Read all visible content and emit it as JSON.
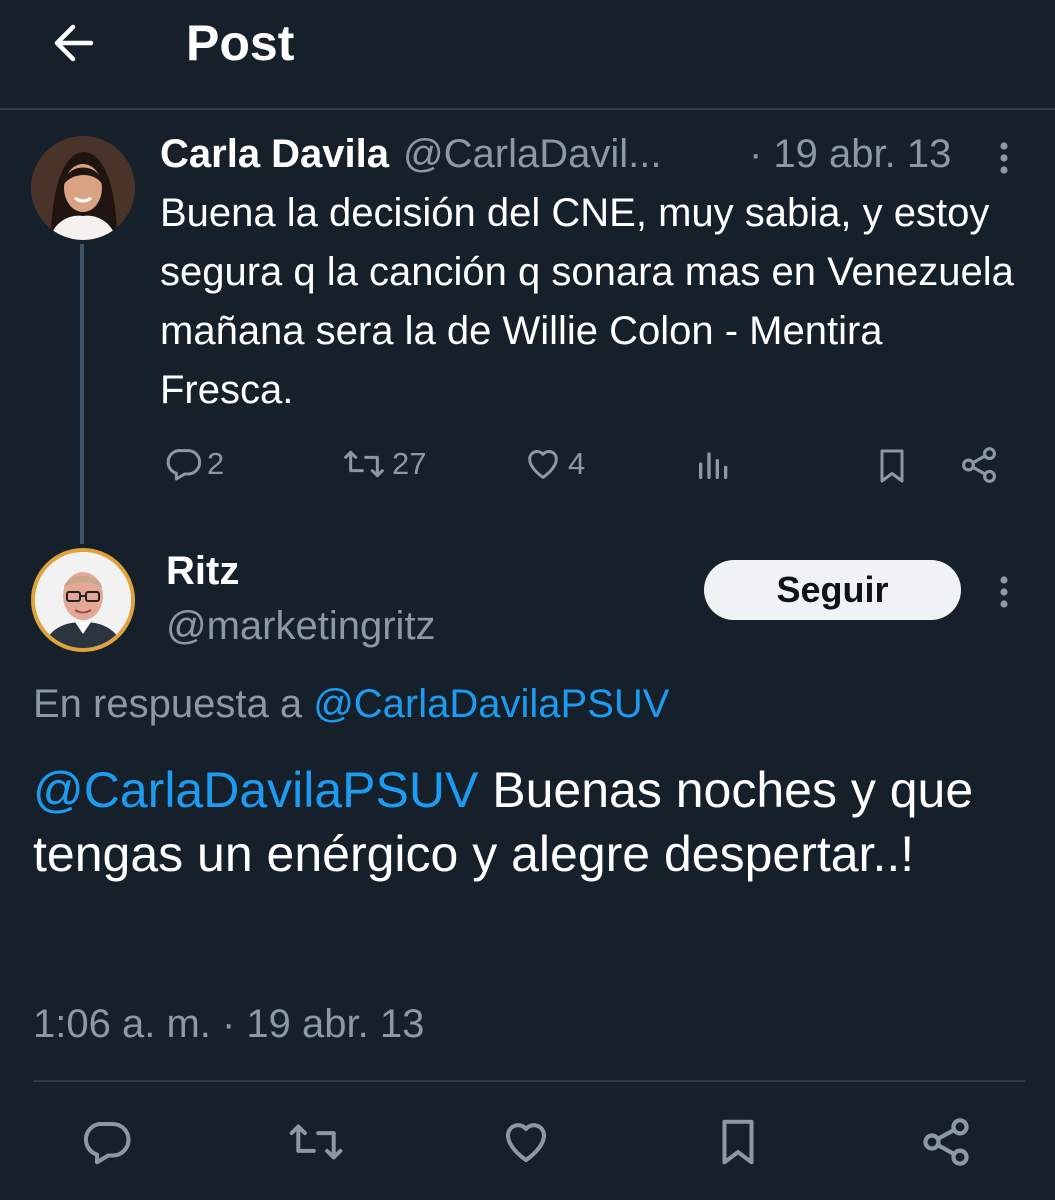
{
  "header": {
    "title": "Post",
    "back_icon": "arrow-left-icon"
  },
  "parent_tweet": {
    "author_name": "Carla Davila",
    "author_handle": "@CarlaDavil...",
    "date": "· 19 abr. 13",
    "text": "Buena la decisión del CNE, muy sabia, y estoy segura q la canción q sonara mas en Venezuela mañana sera la de Willie Colon - Mentira Fresca.",
    "actions": {
      "replies": "2",
      "retweets": "27",
      "likes": "4"
    }
  },
  "reply_tweet": {
    "author_name": "Ritz",
    "author_handle": "@marketingritz",
    "follow_label": "Seguir",
    "reply_to_prefix": "En respuesta a",
    "reply_to_handle": "@CarlaDavilaPSUV",
    "mention": "@CarlaDavilaPSUV",
    "text": "Buenas noches y que tengas un enérgico y alegre despertar..!",
    "timestamp": "1:06 a. m. · 19 abr. 13"
  },
  "colors": {
    "background": "#15202b",
    "text": "#ffffff",
    "muted": "#8b98a5",
    "link": "#1d9bf0",
    "divider": "#2f3a45",
    "follow_button": "#eff3f4"
  }
}
